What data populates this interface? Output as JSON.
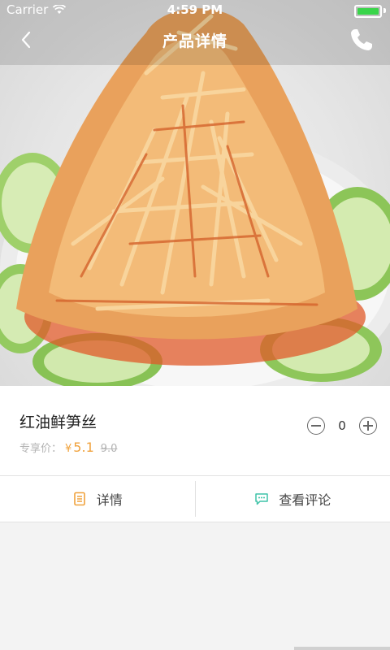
{
  "status_bar": {
    "carrier": "Carrier",
    "time": "4:59 PM",
    "battery_level": 1.0
  },
  "nav": {
    "title": "产品详情",
    "back_icon": "chevron-left-icon",
    "call_icon": "phone-icon"
  },
  "product": {
    "image_icon": "dish-photo",
    "name": "红油鲜笋丝",
    "price_label": "专享价：",
    "currency": "¥",
    "price": "5.1",
    "original_price": "9.0",
    "quantity": "0"
  },
  "tabs": [
    {
      "label": "详情",
      "icon": "document-icon",
      "color": "#f0a23c"
    },
    {
      "label": "查看评论",
      "icon": "chat-bubble-icon",
      "color": "#3fc3a8"
    }
  ],
  "colors": {
    "accent": "#f0a23c",
    "comment_accent": "#3fc3a8",
    "battery": "#39d54a"
  }
}
